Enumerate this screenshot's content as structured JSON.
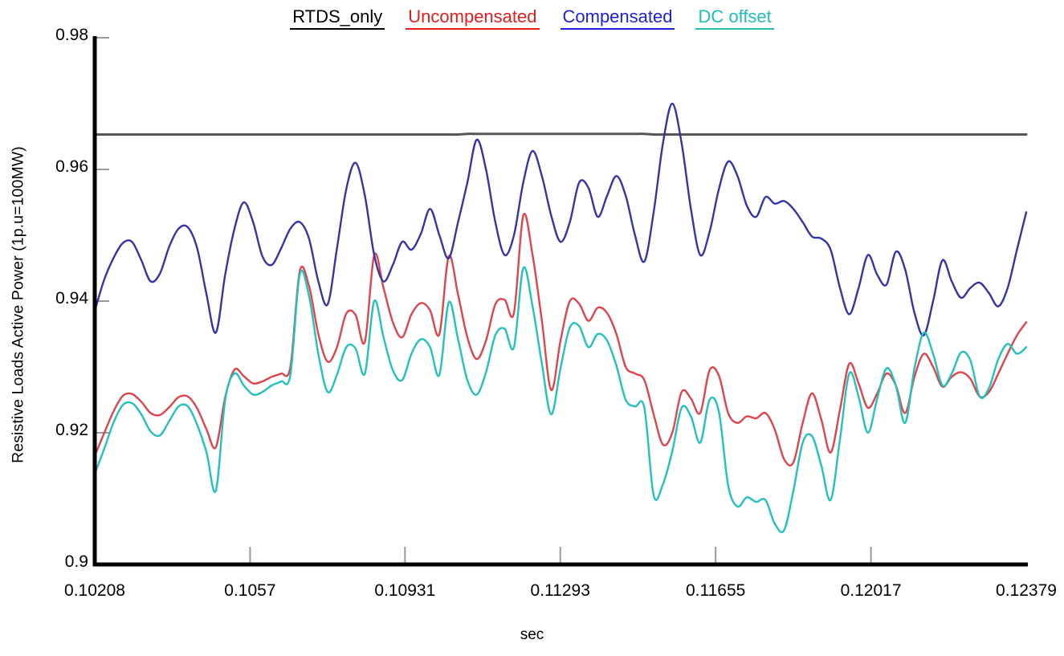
{
  "chart_data": {
    "type": "line",
    "title": "",
    "xlabel": "sec",
    "ylabel": "Resistive Loads Active Power (1p.u=100MW)",
    "xlim": [
      0.10208,
      0.12379
    ],
    "ylim": [
      0.9,
      0.98
    ],
    "grid": false,
    "legend_position": "top-center",
    "xticks": [
      "0.10208",
      "0.1057",
      "0.10931",
      "0.11293",
      "0.11655",
      "0.12017",
      "0.12379"
    ],
    "xtick_values": [
      0.10208,
      0.1057,
      0.10931,
      0.11293,
      0.11655,
      0.12017,
      0.12379
    ],
    "yticks": [
      "0.98",
      "0.96",
      "0.94",
      "0.92",
      "0.9"
    ],
    "ytick_values": [
      0.98,
      0.96,
      0.94,
      0.92,
      0.9
    ],
    "series": [
      {
        "name": "RTDS_only",
        "color": "#555555",
        "values": [
          0.9653,
          0.9653,
          0.9653,
          0.9653,
          0.9653,
          0.9653,
          0.9653,
          0.9653,
          0.9653,
          0.9653,
          0.9653,
          0.9653,
          0.9653,
          0.9653,
          0.9653,
          0.9653,
          0.9653,
          0.9653,
          0.9653,
          0.9653,
          0.9653,
          0.9653,
          0.9653,
          0.9653,
          0.9653,
          0.9653,
          0.9653,
          0.9653,
          0.9653,
          0.9653,
          0.9653,
          0.9653,
          0.9653,
          0.9653,
          0.9653,
          0.9653,
          0.9653,
          0.9653,
          0.9653,
          0.9653,
          0.9654,
          0.9654,
          0.9654,
          0.9654,
          0.9654,
          0.9654,
          0.9654,
          0.9654,
          0.9654,
          0.9654,
          0.9654,
          0.9654,
          0.9654,
          0.9654,
          0.9654,
          0.9654,
          0.9654,
          0.9654,
          0.9654,
          0.9654,
          0.9653,
          0.9653,
          0.9653,
          0.9653,
          0.9653,
          0.9653,
          0.9653,
          0.9653,
          0.9653,
          0.9653,
          0.9653,
          0.9653,
          0.9653,
          0.9653,
          0.9653,
          0.9653,
          0.9653,
          0.9653,
          0.9653,
          0.9653,
          0.9653,
          0.9653,
          0.9653,
          0.9653,
          0.9653,
          0.9653,
          0.9653,
          0.9653,
          0.9653,
          0.9653,
          0.9653,
          0.9653,
          0.9653,
          0.9653,
          0.9653,
          0.9653,
          0.9653,
          0.9653,
          0.9653,
          0.9653,
          0.9653
        ]
      },
      {
        "name": "Uncompensated",
        "color": "#e0434c",
        "values": [
          0.9165,
          0.9199,
          0.9232,
          0.9256,
          0.9259,
          0.9247,
          0.923,
          0.9227,
          0.9239,
          0.9254,
          0.9255,
          0.9237,
          0.9205,
          0.9178,
          0.9254,
          0.9296,
          0.9286,
          0.9275,
          0.9278,
          0.9285,
          0.929,
          0.93,
          0.9445,
          0.9423,
          0.935,
          0.9308,
          0.933,
          0.9381,
          0.9379,
          0.9338,
          0.947,
          0.942,
          0.9368,
          0.9345,
          0.938,
          0.9397,
          0.9386,
          0.935,
          0.9468,
          0.941,
          0.9345,
          0.9312,
          0.934,
          0.9395,
          0.9402,
          0.9382,
          0.953,
          0.947,
          0.937,
          0.9265,
          0.934,
          0.94,
          0.9396,
          0.937,
          0.939,
          0.9382,
          0.935,
          0.93,
          0.929,
          0.928,
          0.9228,
          0.9182,
          0.92,
          0.9262,
          0.9252,
          0.923,
          0.9295,
          0.9287,
          0.923,
          0.9215,
          0.9225,
          0.9222,
          0.923,
          0.9205,
          0.916,
          0.9155,
          0.9215,
          0.926,
          0.922,
          0.917,
          0.9235,
          0.9305,
          0.9275,
          0.9238,
          0.926,
          0.929,
          0.9272,
          0.923,
          0.9285,
          0.932,
          0.93,
          0.927,
          0.9285,
          0.9292,
          0.9282,
          0.9255,
          0.9262,
          0.929,
          0.932,
          0.9348,
          0.9368
        ]
      },
      {
        "name": "Compensated",
        "color": "#3434a8",
        "values": [
          0.9385,
          0.9432,
          0.9465,
          0.9488,
          0.949,
          0.9462,
          0.943,
          0.9442,
          0.9483,
          0.951,
          0.9512,
          0.948,
          0.941,
          0.9352,
          0.944,
          0.951,
          0.955,
          0.952,
          0.9468,
          0.9455,
          0.948,
          0.951,
          0.952,
          0.9495,
          0.943,
          0.9395,
          0.948,
          0.957,
          0.961,
          0.956,
          0.947,
          0.943,
          0.9455,
          0.949,
          0.9478,
          0.9502,
          0.954,
          0.95,
          0.9465,
          0.952,
          0.958,
          0.9645,
          0.96,
          0.952,
          0.947,
          0.95,
          0.958,
          0.9628,
          0.959,
          0.953,
          0.949,
          0.952,
          0.958,
          0.9572,
          0.9528,
          0.956,
          0.959,
          0.956,
          0.95,
          0.946,
          0.9535,
          0.964,
          0.97,
          0.964,
          0.954,
          0.947,
          0.9505,
          0.957,
          0.9612,
          0.959,
          0.9545,
          0.9528,
          0.9558,
          0.9548,
          0.9552,
          0.954,
          0.952,
          0.9498,
          0.9495,
          0.9478,
          0.942,
          0.938,
          0.942,
          0.947,
          0.944,
          0.9425,
          0.9475,
          0.9448,
          0.9382,
          0.9348,
          0.94,
          0.9462,
          0.943,
          0.9405,
          0.942,
          0.9428,
          0.9412,
          0.9392,
          0.942,
          0.9478,
          0.9535
        ]
      },
      {
        "name": "DC offset",
        "color": "#22c1bd",
        "values": [
          0.9138,
          0.9175,
          0.9215,
          0.9242,
          0.9245,
          0.9228,
          0.9202,
          0.9196,
          0.9218,
          0.924,
          0.924,
          0.9212,
          0.917,
          0.9112,
          0.925,
          0.929,
          0.9272,
          0.9258,
          0.9262,
          0.9272,
          0.9278,
          0.9288,
          0.944,
          0.9408,
          0.932,
          0.9262,
          0.9288,
          0.933,
          0.9328,
          0.929,
          0.94,
          0.9345,
          0.9295,
          0.928,
          0.932,
          0.9342,
          0.933,
          0.9288,
          0.9398,
          0.9342,
          0.928,
          0.9258,
          0.9292,
          0.9348,
          0.9358,
          0.933,
          0.945,
          0.9392,
          0.9305,
          0.9228,
          0.9298,
          0.936,
          0.9362,
          0.933,
          0.935,
          0.934,
          0.9302,
          0.925,
          0.924,
          0.9238,
          0.9105,
          0.9122,
          0.9172,
          0.9238,
          0.9225,
          0.9185,
          0.925,
          0.9232,
          0.912,
          0.9088,
          0.9102,
          0.9095,
          0.9098,
          0.9062,
          0.9052,
          0.9112,
          0.9185,
          0.9195,
          0.915,
          0.9098,
          0.919,
          0.929,
          0.9255,
          0.92,
          0.9252,
          0.9298,
          0.9272,
          0.9215,
          0.9298,
          0.9352,
          0.932,
          0.9272,
          0.929,
          0.9322,
          0.931,
          0.9255,
          0.9268,
          0.9312,
          0.9335,
          0.932,
          0.933
        ]
      }
    ]
  },
  "legend": {
    "entries": [
      {
        "label": "RTDS_only",
        "color": "#000000"
      },
      {
        "label": "Uncompensated",
        "color": "#e21f1f"
      },
      {
        "label": "Compensated",
        "color": "#1f1fd8"
      },
      {
        "label": "DC offset",
        "color": "#1fbdb8"
      }
    ]
  }
}
